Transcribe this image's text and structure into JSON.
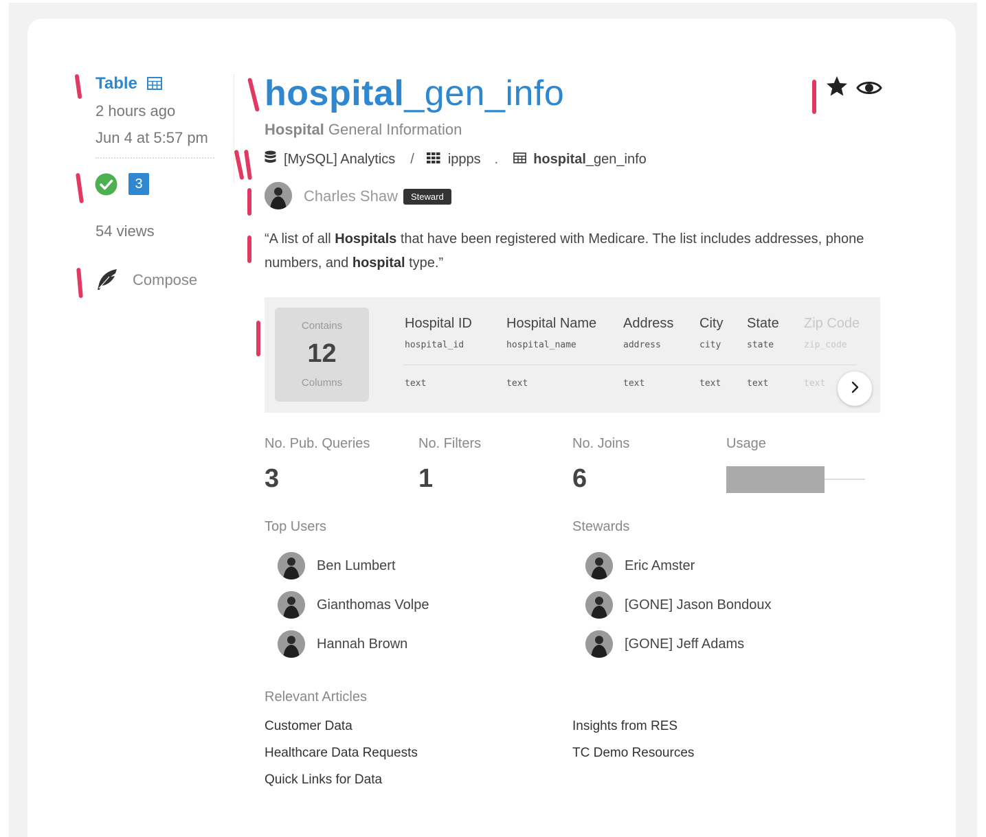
{
  "sidebar": {
    "type_label": "Table",
    "relative_time": "2 hours ago",
    "timestamp": "Jun 4 at 5:57 pm",
    "badge_count": "3",
    "views": "54 views",
    "compose_label": "Compose"
  },
  "header": {
    "title_bold": "hospital",
    "title_rest": "_gen_info",
    "subtitle_bold": "Hospital",
    "subtitle_rest": " General Information",
    "breadcrumb": {
      "datasource": "[MySQL] Analytics",
      "sep1": "/",
      "schema": "ippps",
      "sep2": ".",
      "table_bold": "hospital",
      "table_rest": "_gen_info"
    },
    "owner_name": "Charles Shaw",
    "owner_role": "Steward",
    "description": {
      "p1": "“A list of all ",
      "b1": "Hospitals",
      "p2": " that have been registered with Medicare. The list includes addresses, phone numbers, and ",
      "b2": "hospital",
      "p3": " type.”"
    }
  },
  "columns_panel": {
    "contains_label": "Contains",
    "count": "12",
    "columns_label": "Columns",
    "columns": [
      {
        "name": "Hospital ID",
        "field": "hospital_id",
        "type": "text"
      },
      {
        "name": "Hospital Name",
        "field": "hospital_name",
        "type": "text"
      },
      {
        "name": "Address",
        "field": "address",
        "type": "text"
      },
      {
        "name": "City",
        "field": "city",
        "type": "text"
      },
      {
        "name": "State",
        "field": "state",
        "type": "text"
      },
      {
        "name": "Zip Code",
        "field": "zip_code",
        "type": "text"
      }
    ]
  },
  "stats": {
    "queries_label": "No. Pub. Queries",
    "queries_value": "3",
    "filters_label": "No. Filters",
    "filters_value": "1",
    "joins_label": "No. Joins",
    "joins_value": "6",
    "usage_label": "Usage",
    "usage_fraction": 0.71
  },
  "top_users": {
    "label": "Top Users",
    "users": [
      "Ben Lumbert",
      "Gianthomas Volpe",
      "Hannah Brown"
    ]
  },
  "stewards": {
    "label": "Stewards",
    "users": [
      "Eric Amster",
      "[GONE] Jason Bondoux",
      "[GONE] Jeff Adams"
    ]
  },
  "articles": {
    "label": "Relevant Articles",
    "left": [
      "Customer Data",
      "Healthcare Data Requests",
      "Quick Links for Data"
    ],
    "right": [
      "Insights from RES",
      "TC Demo Resources"
    ]
  },
  "colors": {
    "accent": "#2f87cf",
    "success": "#4caf50",
    "annotation": "#e03a62"
  }
}
